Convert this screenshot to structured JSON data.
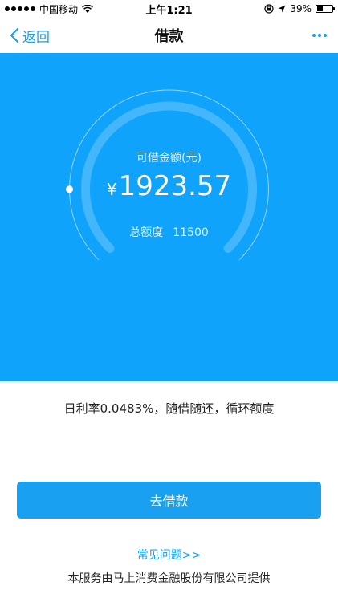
{
  "status_bar": {
    "carrier": "中国移动",
    "time": "上午1:21",
    "battery": "39%",
    "battery_level": 0.39
  },
  "nav": {
    "back_label": "返回",
    "title": "借款"
  },
  "credit": {
    "available_label": "可借金额(元)",
    "currency_symbol": "¥",
    "available_amount": "1923.57",
    "total_label": "总额度",
    "total_value": "11500",
    "used_fraction": 0.167
  },
  "info": {
    "rate_text": "日利率0.0483%，随借随还，循环额度"
  },
  "actions": {
    "borrow_label": "去借款",
    "faq_label": "常见问题>>"
  },
  "footer": {
    "provider_text": "本服务由马上消费金融股份有限公司提供"
  },
  "colors": {
    "brand_blue": "#10a3fb",
    "link_blue": "#1aa0f0"
  }
}
